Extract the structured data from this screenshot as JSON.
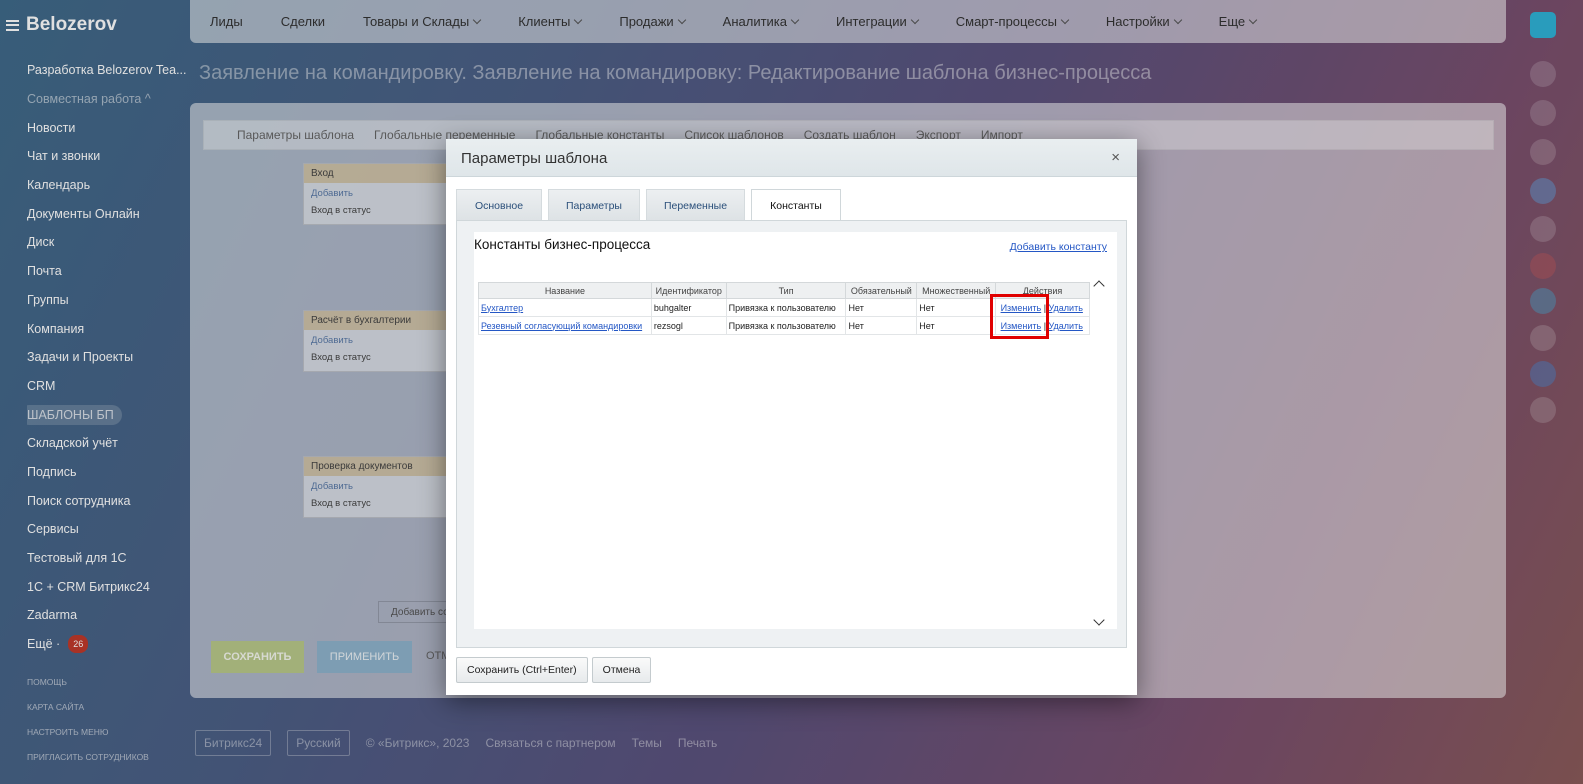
{
  "brand": "Belozerov",
  "sidebar": {
    "items": [
      {
        "label": "Разработка Belozerov Tea..."
      },
      {
        "label": "Совместная работа ^"
      },
      {
        "label": "Новости"
      },
      {
        "label": "Чат и звонки"
      },
      {
        "label": "Календарь"
      },
      {
        "label": "Документы Онлайн"
      },
      {
        "label": "Диск"
      },
      {
        "label": "Почта"
      },
      {
        "label": "Группы"
      },
      {
        "label": "Компания"
      },
      {
        "label": "Задачи и Проекты"
      },
      {
        "label": "CRM"
      },
      {
        "label": "ШАБЛОНЫ БП"
      },
      {
        "label": "Складской учёт"
      },
      {
        "label": "Подпись"
      },
      {
        "label": "Поиск сотрудника"
      },
      {
        "label": "Сервисы"
      },
      {
        "label": "Тестовый для 1С"
      },
      {
        "label": "1С + CRM Битрикс24"
      },
      {
        "label": "Zadarma"
      },
      {
        "label": "Ещё ·",
        "badge": "26"
      }
    ],
    "small": [
      "ПОМОЩЬ",
      "КАРТА САЙТА",
      "НАСТРОИТЬ МЕНЮ",
      "ПРИГЛАСИТЬ СОТРУДНИКОВ"
    ]
  },
  "topnav": [
    "Лиды",
    "Сделки",
    "Товары и Склады",
    "Клиенты",
    "Продажи",
    "Аналитика",
    "Интеграции",
    "Смарт-процессы",
    "Настройки",
    "Еще"
  ],
  "page_title": "Заявление на командировку. Заявление на командировку: Редактирование шаблона бизнес-процесса",
  "workspace": {
    "toolbar": [
      "Параметры шаблона",
      "Глобальные переменные",
      "Глобальные константы",
      "Список шаблонов",
      "Создать шаблон",
      "Экспорт",
      "Импорт"
    ],
    "blocks": [
      {
        "title": "Вход",
        "add": "Добавить",
        "item": "Вход в статус"
      },
      {
        "title": "Расчёт в бухгалтерии",
        "add": "Добавить",
        "item": "Вход в статус"
      },
      {
        "title": "Проверка документов",
        "add": "Добавить",
        "item": "Вход в статус"
      }
    ],
    "add_state": "Добавить со",
    "save": "СОХРАНИТЬ",
    "apply": "ПРИМЕНИТЬ",
    "cancel": "ОТМ"
  },
  "footer": {
    "logo": "Битрикс24",
    "lang": "Русский",
    "copyright": "© «Битрикс», 2023",
    "partner": "Связаться с партнером",
    "themes": "Темы",
    "print": "Печать"
  },
  "dialog": {
    "title": "Параметры шаблона",
    "close": "×",
    "tabs": [
      "Основное",
      "Параметры",
      "Переменные",
      "Константы"
    ],
    "active_tab": 3,
    "section_title": "Константы бизнес-процесса",
    "add_constant": "Добавить константу",
    "columns": [
      "Название",
      "Идентификатор",
      "Тип",
      "Обязательный",
      "Множественный",
      "Действия"
    ],
    "rows": [
      {
        "name": "Бухгалтер",
        "id": "buhgalter",
        "type": "Привязка к пользователю",
        "required": "Нет",
        "multiple": "Нет",
        "edit": "Изменить",
        "delete": "Удалить"
      },
      {
        "name": "Резевный согласующий командировки",
        "id": "rezsogl",
        "type": "Привязка к пользователю",
        "required": "Нет",
        "multiple": "Нет",
        "edit": "Изменить",
        "delete": "Удалить"
      }
    ],
    "save_button": "Сохранить (Ctrl+Enter)",
    "cancel_button": "Отмена"
  },
  "colors": {
    "highlight": "#e00000",
    "link": "#2457c5"
  }
}
